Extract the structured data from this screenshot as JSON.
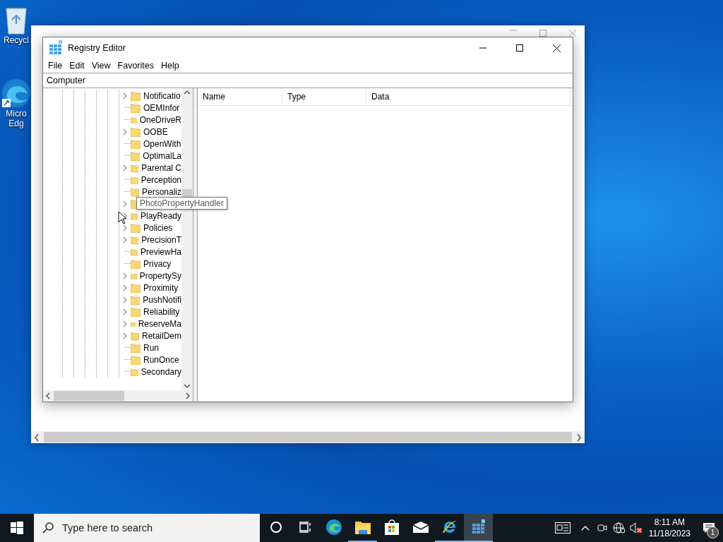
{
  "desktop_icons": [
    {
      "kind": "recycle",
      "lines": [
        "Recycl"
      ]
    },
    {
      "kind": "edge",
      "lines": [
        "Micro",
        "Edg"
      ]
    }
  ],
  "window": {
    "title": "Registry Editor",
    "menu": [
      "File",
      "Edit",
      "View",
      "Favorites",
      "Help"
    ],
    "address": "Computer",
    "tree": [
      {
        "label": "Notificatio",
        "expandable": true
      },
      {
        "label": "OEMInfor",
        "expandable": false
      },
      {
        "label": "OneDriveR",
        "expandable": false
      },
      {
        "label": "OOBE",
        "expandable": true
      },
      {
        "label": "OpenWith",
        "expandable": false
      },
      {
        "label": "OptimalLa",
        "expandable": false
      },
      {
        "label": "Parental C",
        "expandable": true
      },
      {
        "label": "Perception",
        "expandable": false
      },
      {
        "label": "Personaliz",
        "expandable": false
      },
      {
        "expandable": true
      },
      {
        "label": "PlayReady",
        "expandable": true
      },
      {
        "label": "Policies",
        "expandable": true
      },
      {
        "label": "PrecisionT",
        "expandable": true
      },
      {
        "label": "PreviewHa",
        "expandable": false
      },
      {
        "label": "Privacy",
        "expandable": false
      },
      {
        "label": "PropertySy",
        "expandable": true
      },
      {
        "label": "Proximity",
        "expandable": true
      },
      {
        "label": "PushNotifi",
        "expandable": true
      },
      {
        "label": "Reliability",
        "expandable": true
      },
      {
        "label": "ReserveMa",
        "expandable": true
      },
      {
        "label": "RetailDem",
        "expandable": true
      },
      {
        "label": "Run",
        "expandable": false
      },
      {
        "label": "RunOnce",
        "expandable": false
      },
      {
        "label": "Secondary",
        "expandable": false
      }
    ],
    "tooltip": "PhotoPropertyHandler",
    "columns": [
      "Name",
      "Type",
      "Data"
    ]
  },
  "taskbar": {
    "search_placeholder": "Type here to search",
    "apps": [
      {
        "kind": "cortana",
        "selected": false,
        "running": false
      },
      {
        "kind": "taskview",
        "selected": false,
        "running": false
      },
      {
        "kind": "edge",
        "selected": false,
        "running": false
      },
      {
        "kind": "explorer",
        "selected": false,
        "running": true
      },
      {
        "kind": "store",
        "selected": false,
        "running": false
      },
      {
        "kind": "mail",
        "selected": false,
        "running": false
      },
      {
        "kind": "ie",
        "selected": false,
        "running": true
      },
      {
        "kind": "regedit",
        "selected": true,
        "running": true
      }
    ],
    "time": "8:11 AM",
    "date": "11/18/2023",
    "notification_count": "1"
  }
}
